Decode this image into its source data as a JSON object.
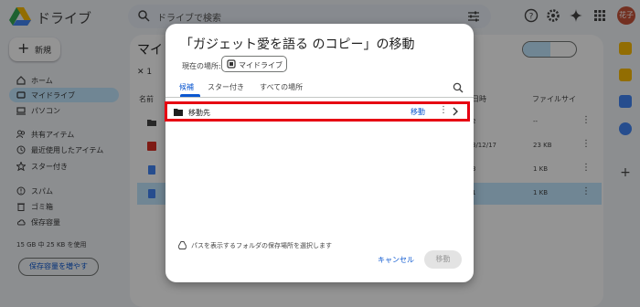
{
  "app": {
    "title": "ドライブ"
  },
  "search": {
    "placeholder": "ドライブで検索"
  },
  "account": {
    "initials": "花子"
  },
  "new_button": {
    "label": "新規"
  },
  "sidebar": {
    "items": [
      {
        "label": "ホーム"
      },
      {
        "label": "マイドライブ"
      },
      {
        "label": "パソコン"
      },
      {
        "label": "共有アイテム"
      },
      {
        "label": "最近使用したアイテム"
      },
      {
        "label": "スター付き"
      },
      {
        "label": "スパム"
      },
      {
        "label": "ゴミ箱"
      },
      {
        "label": "保存容量"
      }
    ],
    "storage_text": "15 GB 中 25 KB を使用",
    "storage_button": "保存容量を増やす"
  },
  "main": {
    "title": "マイ",
    "selection_count": "1",
    "columns": {
      "name": "名前",
      "date": "日時",
      "size": "ファイルサイ"
    },
    "rows": [
      {
        "date": "2",
        "size": "--"
      },
      {
        "date": "3/12/17",
        "size": "23 KB"
      },
      {
        "date": "3",
        "size": "1 KB"
      },
      {
        "date": "1",
        "size": "1 KB"
      }
    ]
  },
  "dialog": {
    "title": "「ガジェット愛を語る のコピー」の移動",
    "current_location_label": "現在の場所:",
    "current_location": "マイドライブ",
    "tabs": [
      {
        "label": "候補"
      },
      {
        "label": "スター付き"
      },
      {
        "label": "すべての場所"
      }
    ],
    "destination_row": {
      "name": "移動先",
      "move_label": "移動"
    },
    "hint": "パスを表示するフォルダの保存場所を選択します",
    "cancel_label": "キャンセル",
    "move_label": "移動"
  },
  "colors": {
    "accent": "#0b57d0",
    "active_nav": "#c2e7ff",
    "highlight_border": "#e60012"
  }
}
